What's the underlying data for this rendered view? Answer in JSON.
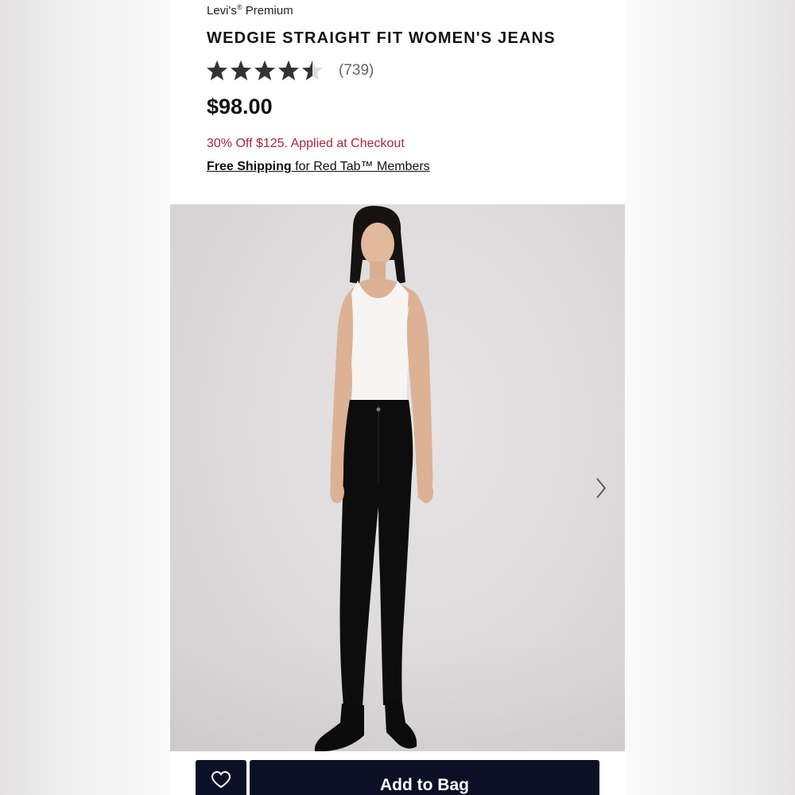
{
  "product": {
    "brand": "Levi's",
    "brand_mark": "®",
    "brand_line": "Premium",
    "title": "WEDGIE STRAIGHT FIT WOMEN'S JEANS",
    "rating": 4.5,
    "rating_max": 5,
    "review_count": "(739)",
    "price": "$98.00",
    "promo": "30% Off $125. Applied at Checkout",
    "shipping_bold": "Free Shipping",
    "shipping_rest": " for Red Tab™ Members"
  },
  "gallery": {
    "next_icon": "chevron-right-icon"
  },
  "actions": {
    "wishlist_icon": "heart-icon",
    "add_to_bag": "Add to Bag"
  },
  "colors": {
    "accent": "#0b1026",
    "promo": "#a8273a",
    "star_filled": "#333333",
    "star_empty": "#dcdcdc"
  }
}
